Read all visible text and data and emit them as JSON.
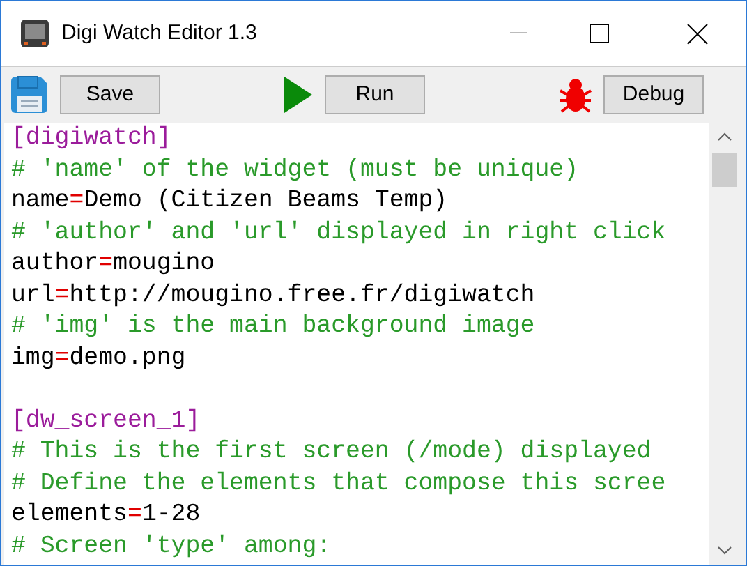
{
  "window": {
    "title": "Digi Watch Editor 1.3"
  },
  "toolbar": [
    {
      "kind": "save",
      "label": "Save"
    },
    {
      "kind": "run",
      "label": "Run"
    },
    {
      "kind": "debug",
      "label": "Debug"
    }
  ],
  "editor": {
    "lines": [
      {
        "kind": "section",
        "text": "[digiwatch]"
      },
      {
        "kind": "comment",
        "text": "# 'name' of the widget (must be unique)"
      },
      {
        "kind": "pair",
        "key": "name",
        "sep": "=",
        "value": "Demo (Citizen Beams Temp)"
      },
      {
        "kind": "comment",
        "text": "# 'author' and 'url' displayed in right click"
      },
      {
        "kind": "pair",
        "key": "author",
        "sep": "=",
        "value": "mougino"
      },
      {
        "kind": "pair",
        "key": "url",
        "sep": "=",
        "value": "http://mougino.free.fr/digiwatch"
      },
      {
        "kind": "comment",
        "text": "# 'img' is the main background image"
      },
      {
        "kind": "pair",
        "key": "img",
        "sep": "=",
        "value": "demo.png"
      },
      {
        "kind": "blank"
      },
      {
        "kind": "section",
        "text": "[dw_screen_1]"
      },
      {
        "kind": "comment",
        "text": "# This is the first screen (/mode) displayed"
      },
      {
        "kind": "comment",
        "text": "# Define the elements that compose this scree"
      },
      {
        "kind": "pair",
        "key": "elements",
        "sep": "=",
        "value": "1-28"
      },
      {
        "kind": "comment",
        "text": "# Screen 'type' among:"
      }
    ]
  }
}
